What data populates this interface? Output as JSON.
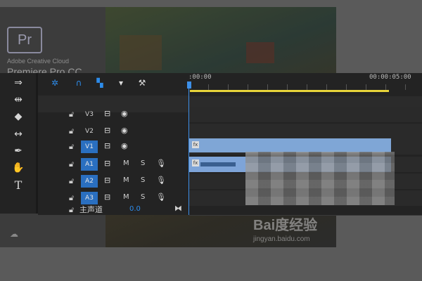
{
  "splash": {
    "logo_text": "Pr",
    "company": "Adobe Creative Cloud",
    "product": "Premiere Pro CC",
    "cloud_icon": "cc-icon"
  },
  "watermark": {
    "logo": "Bai度经验",
    "url": "jingyan.baidu.com"
  },
  "toolbar": {
    "items": [
      {
        "name": "track-select-icon",
        "glyph": "⇒"
      },
      {
        "name": "ripple-edit-icon",
        "glyph": "⇹"
      },
      {
        "name": "razor-icon",
        "glyph": "◆"
      },
      {
        "name": "slip-icon",
        "glyph": "↔"
      },
      {
        "name": "pen-icon",
        "glyph": "✒"
      },
      {
        "name": "hand-icon",
        "glyph": "✋"
      },
      {
        "name": "type-icon",
        "glyph": "T"
      }
    ]
  },
  "timeline": {
    "controls": [
      "snap-icon",
      "magnet-icon",
      "linked-selection-icon",
      "marker-icon",
      "wrench-icon"
    ],
    "ruler": {
      "start": ":00:00",
      "end": "00:00:05:00"
    },
    "tracks": [
      {
        "target": "V3",
        "on": false,
        "kind": "video"
      },
      {
        "target": "V2",
        "on": false,
        "kind": "video"
      },
      {
        "target": "V1",
        "on": true,
        "kind": "video"
      },
      {
        "target": "A1",
        "on": true,
        "kind": "audio",
        "m": "M",
        "s": "S"
      },
      {
        "target": "A2",
        "on": true,
        "kind": "audio",
        "m": "M",
        "s": "S"
      },
      {
        "target": "A3",
        "on": true,
        "kind": "audio",
        "m": "M",
        "s": "S"
      }
    ],
    "master": {
      "label": "主声道",
      "value": "0.0"
    },
    "clips": {
      "fx": "fx"
    }
  },
  "colors": {
    "accent": "#2d8ceb",
    "workarea": "#e8d43a",
    "clip": "#7fa6d6"
  }
}
